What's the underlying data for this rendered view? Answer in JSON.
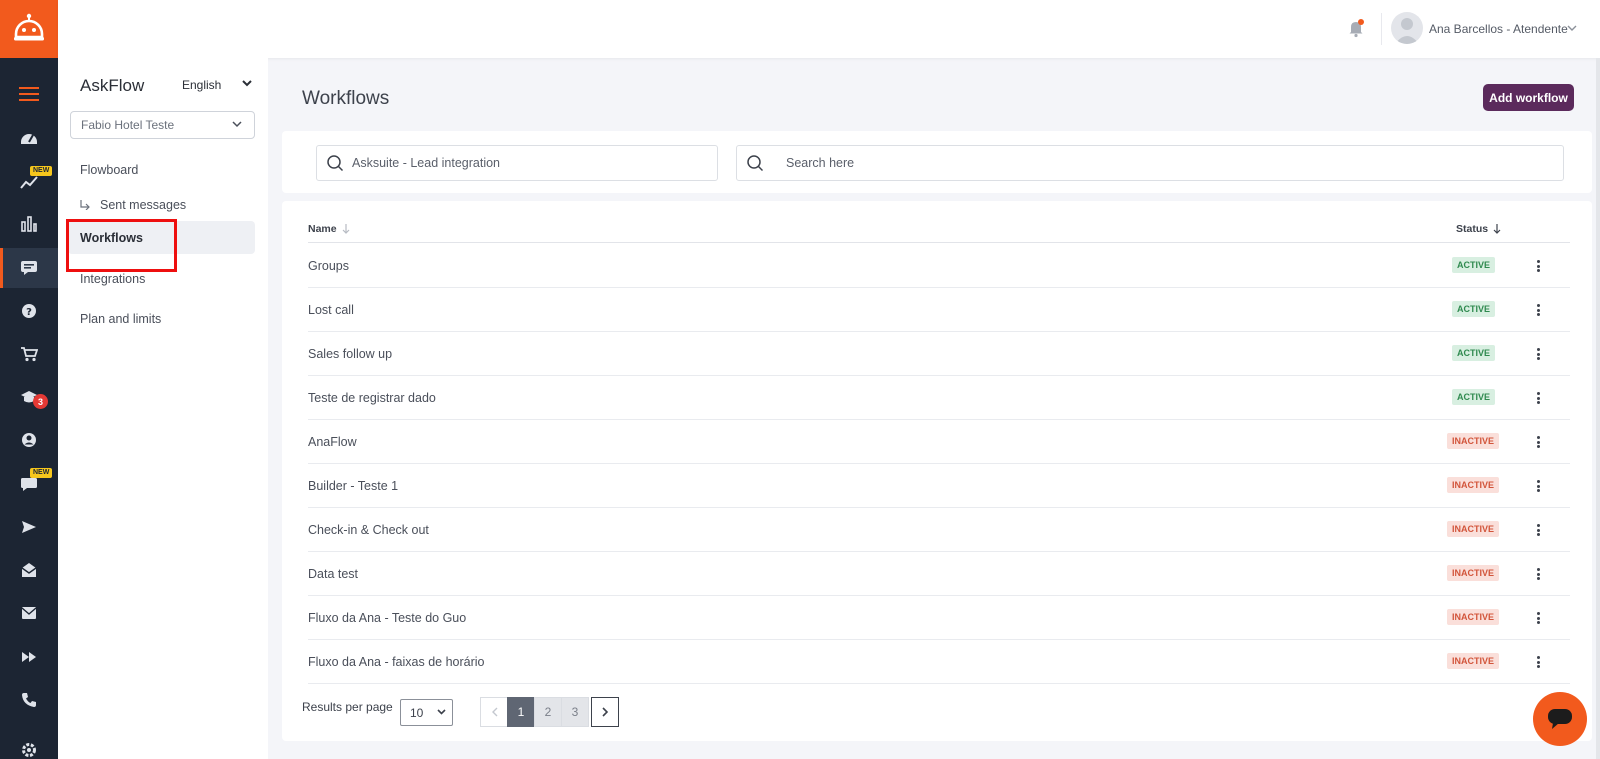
{
  "header": {
    "user_name": "Ana Barcellos - Atendente"
  },
  "rail": {
    "items": [
      {
        "icon": "menu-icon"
      },
      {
        "icon": "dashboard-icon"
      },
      {
        "icon": "trend-icon",
        "badge": "NEW"
      },
      {
        "icon": "bar-chart-icon"
      },
      {
        "icon": "chat-flow-icon",
        "active": true
      },
      {
        "icon": "help-icon"
      },
      {
        "icon": "cart-icon"
      },
      {
        "icon": "graduation-icon",
        "count": "3"
      },
      {
        "icon": "account-icon"
      },
      {
        "icon": "message-icon",
        "badge": "NEW"
      },
      {
        "icon": "send-icon"
      },
      {
        "icon": "mail-open-icon"
      },
      {
        "icon": "mail-icon"
      },
      {
        "icon": "fast-forward-icon"
      },
      {
        "icon": "phone-icon"
      },
      {
        "icon": "settings-icon"
      }
    ]
  },
  "sidebar": {
    "app_title": "AskFlow",
    "language": "English",
    "hotel": "Fabio Hotel Teste",
    "items": [
      {
        "label": "Flowboard"
      },
      {
        "label": "Sent messages"
      },
      {
        "label": "Workflows"
      },
      {
        "label": "Integrations"
      },
      {
        "label": "Plan and limits"
      }
    ]
  },
  "main": {
    "title": "Workflows",
    "add_button": "Add workflow",
    "filter_value": "Asksuite - Lead integration",
    "search_placeholder": "Search here"
  },
  "table": {
    "columns": {
      "name": "Name",
      "status": "Status"
    },
    "rows": [
      {
        "name": "Groups",
        "status": "ACTIVE"
      },
      {
        "name": "Lost call",
        "status": "ACTIVE"
      },
      {
        "name": "Sales follow up",
        "status": "ACTIVE"
      },
      {
        "name": "Teste de registrar dado",
        "status": "ACTIVE"
      },
      {
        "name": "AnaFlow",
        "status": "INACTIVE"
      },
      {
        "name": "Builder - Teste 1",
        "status": "INACTIVE"
      },
      {
        "name": "Check-in & Check out",
        "status": "INACTIVE"
      },
      {
        "name": "Data test",
        "status": "INACTIVE"
      },
      {
        "name": "Fluxo da Ana - Teste do Guo",
        "status": "INACTIVE"
      },
      {
        "name": "Fluxo da Ana - faixas de horário",
        "status": "INACTIVE"
      }
    ]
  },
  "pagination": {
    "results_label": "Results per page",
    "per_page": "10",
    "pages": [
      "1",
      "2",
      "3"
    ],
    "current": "1"
  },
  "colors": {
    "brand_orange": "#f25a1d",
    "rail_dark": "#1c2533",
    "add_button": "#5b2a5c",
    "active_badge": "#2f8a4f",
    "inactive_badge": "#d2553b",
    "highlight": "#ee0f0f"
  }
}
